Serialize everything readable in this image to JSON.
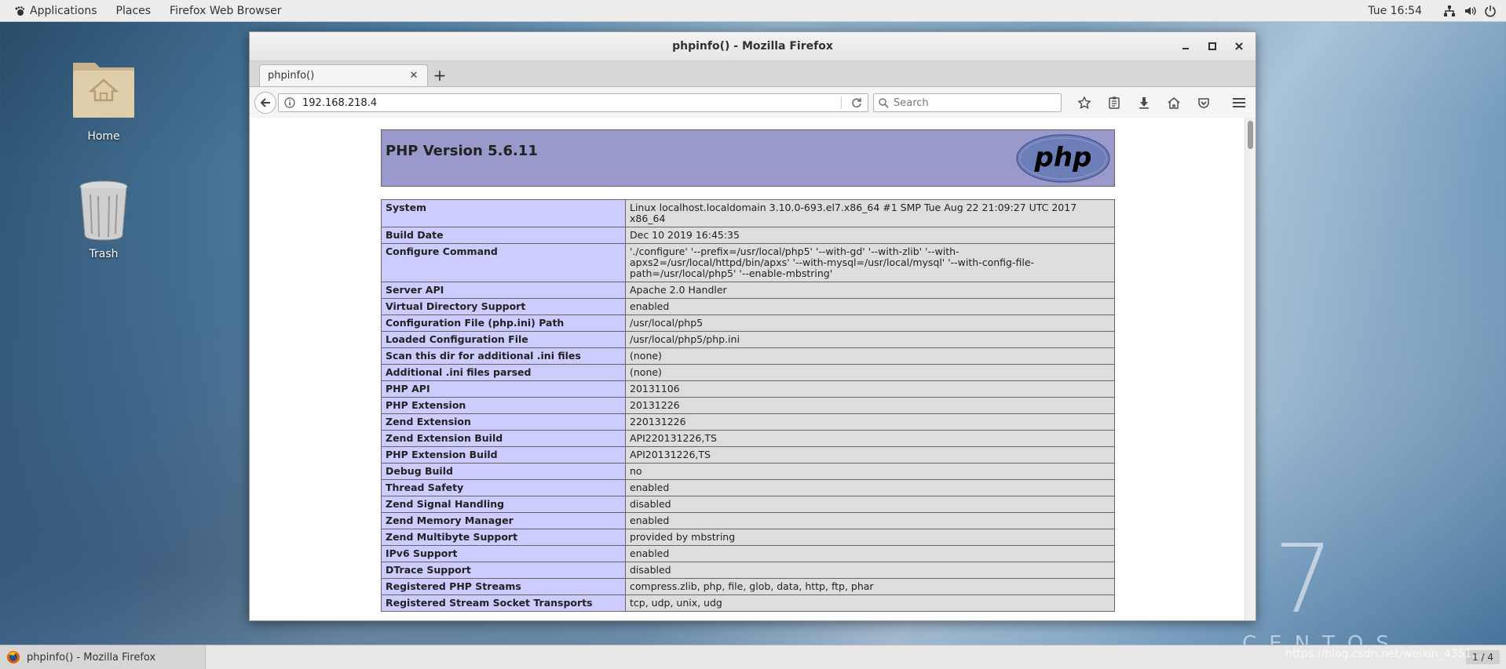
{
  "top_panel": {
    "menus": [
      "Applications",
      "Places",
      "Firefox Web Browser"
    ],
    "clock": "Tue 16:54"
  },
  "desktop": {
    "icons": [
      {
        "label": "Home",
        "icon": "folder-home-icon"
      },
      {
        "label": "Trash",
        "icon": "trash-icon"
      }
    ],
    "watermark_number": "7",
    "watermark_word": "CENTOS"
  },
  "window": {
    "title": "phpinfo() - Mozilla Firefox",
    "tab_title": "phpinfo()",
    "url": "192.168.218.4",
    "search_placeholder": "Search"
  },
  "php": {
    "version_title": "PHP Version 5.6.11",
    "logo_text": "php",
    "rows": [
      {
        "key": "System",
        "value": "Linux localhost.localdomain 3.10.0-693.el7.x86_64 #1 SMP Tue Aug 22 21:09:27 UTC 2017 x86_64"
      },
      {
        "key": "Build Date",
        "value": "Dec 10 2019 16:45:35"
      },
      {
        "key": "Configure Command",
        "value": "'./configure' '--prefix=/usr/local/php5' '--with-gd' '--with-zlib' '--with-apxs2=/usr/local/httpd/bin/apxs' '--with-mysql=/usr/local/mysql' '--with-config-file-path=/usr/local/php5' '--enable-mbstring'"
      },
      {
        "key": "Server API",
        "value": "Apache 2.0 Handler"
      },
      {
        "key": "Virtual Directory Support",
        "value": "enabled"
      },
      {
        "key": "Configuration File (php.ini) Path",
        "value": "/usr/local/php5"
      },
      {
        "key": "Loaded Configuration File",
        "value": "/usr/local/php5/php.ini"
      },
      {
        "key": "Scan this dir for additional .ini files",
        "value": "(none)"
      },
      {
        "key": "Additional .ini files parsed",
        "value": "(none)"
      },
      {
        "key": "PHP API",
        "value": "20131106"
      },
      {
        "key": "PHP Extension",
        "value": "20131226"
      },
      {
        "key": "Zend Extension",
        "value": "220131226"
      },
      {
        "key": "Zend Extension Build",
        "value": "API220131226,TS"
      },
      {
        "key": "PHP Extension Build",
        "value": "API20131226,TS"
      },
      {
        "key": "Debug Build",
        "value": "no"
      },
      {
        "key": "Thread Safety",
        "value": "enabled"
      },
      {
        "key": "Zend Signal Handling",
        "value": "disabled"
      },
      {
        "key": "Zend Memory Manager",
        "value": "enabled"
      },
      {
        "key": "Zend Multibyte Support",
        "value": "provided by mbstring"
      },
      {
        "key": "IPv6 Support",
        "value": "enabled"
      },
      {
        "key": "DTrace Support",
        "value": "disabled"
      },
      {
        "key": "Registered PHP Streams",
        "value": "compress.zlib, php, file, glob, data, http, ftp, phar"
      },
      {
        "key": "Registered Stream Socket Transports",
        "value": "tcp, udp, unix, udg"
      }
    ]
  },
  "taskbar": {
    "task_label": "phpinfo() - Mozilla Firefox",
    "workspace": "1 / 4",
    "watermark": "https://blog.csdn.net/weixin_4351..."
  },
  "colors": {
    "php_header": "#9999cc",
    "php_key_cell": "#ccccff",
    "php_value_cell": "#dddddd",
    "panel": "#ededed"
  }
}
